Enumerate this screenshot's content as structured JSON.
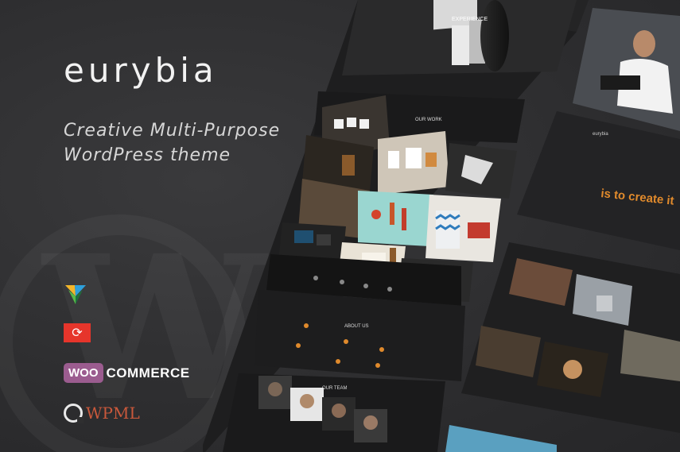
{
  "brand": {
    "name": "eurybia"
  },
  "tagline": {
    "line1": "Creative Multi-Purpose",
    "line2": "WordPress theme"
  },
  "badges": {
    "woocommerce_woo": "WOO",
    "woocommerce_commerce": "COMMERCE",
    "wpml": "WPML",
    "refresh_symbol": "⟳"
  },
  "mockup_main": {
    "hero_label": "EXPERIENCE",
    "work_title": "OUR WORK",
    "about_title": "ABOUT US",
    "team_title": "OUR TEAM"
  },
  "mockup_right": {
    "brand": "eurybia",
    "headline": "is to create it"
  },
  "colors": {
    "background": "#2f2f30",
    "accent_orange": "#e08a2c",
    "woo_purple": "#9b5c8f",
    "wpml_red": "#c9583b",
    "refresh_red": "#e6352b"
  }
}
